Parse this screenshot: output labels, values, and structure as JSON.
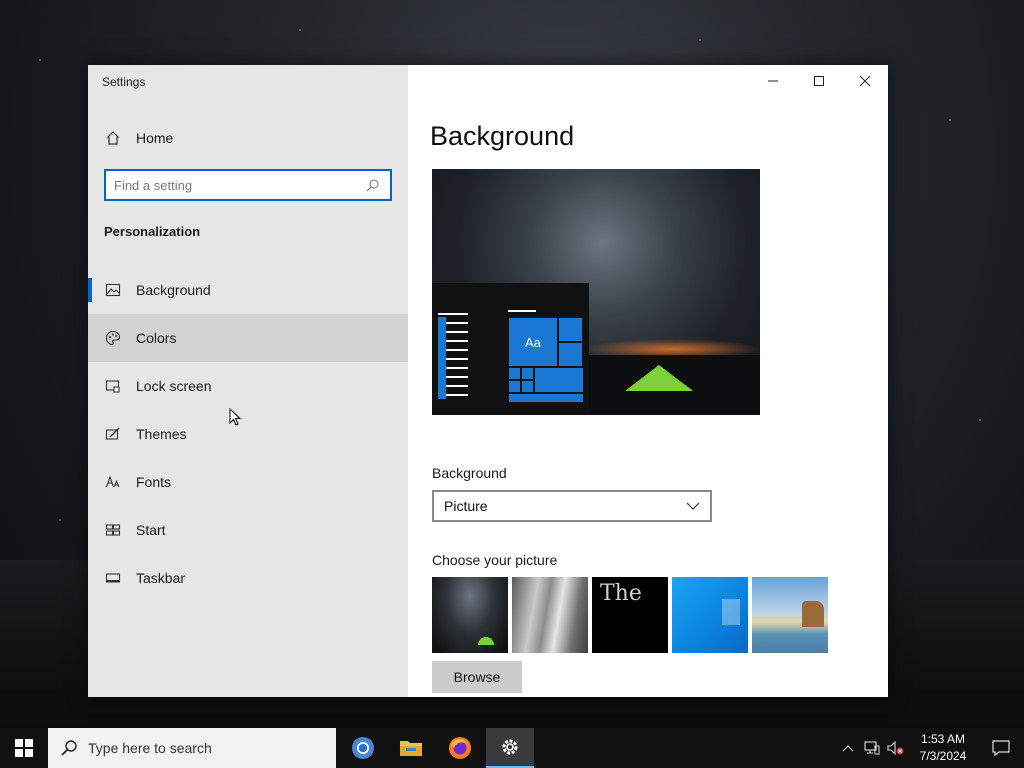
{
  "window": {
    "title": "Settings",
    "controls": {
      "minimize": "—",
      "maximize": "☐",
      "close": "✕"
    }
  },
  "sidebar": {
    "home_label": "Home",
    "search_placeholder": "Find a setting",
    "section_title": "Personalization",
    "items": [
      {
        "label": "Background",
        "icon": "image-icon"
      },
      {
        "label": "Colors",
        "icon": "palette-icon"
      },
      {
        "label": "Lock screen",
        "icon": "lock-screen-icon"
      },
      {
        "label": "Themes",
        "icon": "themes-icon"
      },
      {
        "label": "Fonts",
        "icon": "fonts-icon"
      },
      {
        "label": "Start",
        "icon": "start-icon"
      },
      {
        "label": "Taskbar",
        "icon": "taskbar-icon"
      }
    ],
    "active_index": 0,
    "hover_index": 1
  },
  "main": {
    "title": "Background",
    "preview": {
      "tile_text": "Aa"
    },
    "background_label": "Background",
    "background_value": "Picture",
    "choose_label": "Choose your picture",
    "thumb_3_text": "The",
    "browse_label": "Browse"
  },
  "taskbar": {
    "search_placeholder": "Type here to search",
    "apps": [
      "chrome-icon",
      "file-explorer-icon",
      "firefox-icon",
      "settings-icon"
    ],
    "time": "1:53 AM",
    "date": "7/3/2024",
    "accent": "#0a64c8"
  }
}
